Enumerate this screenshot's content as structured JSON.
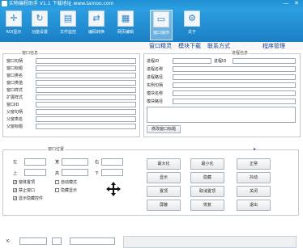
{
  "titlebar": {
    "title": "实物编程助手 V1.1 下载地址 www.tamoo.com",
    "minimize": "—",
    "close": "✕"
  },
  "toolbar": {
    "items": [
      {
        "label": "ROI显示",
        "icon": "✛"
      },
      {
        "label": "功能设置",
        "icon": "↻"
      },
      {
        "label": "文件监控",
        "icon": "▤"
      },
      {
        "label": "编码转换",
        "icon": "⇄"
      },
      {
        "label": "网页编辑",
        "icon": "▦"
      },
      {
        "label": "窗口操作",
        "icon": "▭"
      },
      {
        "label": "关于",
        "icon": "⚙"
      }
    ]
  },
  "menu": {
    "items": [
      "窗口精灵",
      "模块下载",
      "联系方式",
      "程序管理"
    ]
  },
  "window_group": {
    "title": "窗口信息",
    "fields": [
      "窗口句柄",
      "窗口标题",
      "窗口类名",
      "窗口类值",
      "窗口样式",
      "扩展样式",
      "窗口ID",
      "父窗句柄",
      "父窗类名",
      "父窗标题"
    ]
  },
  "process_group": {
    "title": "进程信息",
    "process_id_label": "进程ID",
    "thread_id_label": "进程ID",
    "fields": [
      "进程名称",
      "进程路径",
      "实例句柄",
      "模块名称",
      "模块路径"
    ],
    "modify_title_button": "修改窗口标题"
  },
  "position_group": {
    "title": "窗口位置",
    "left": "左",
    "width": "宽",
    "right": "右",
    "top": "上",
    "height": "高",
    "bottom": "下",
    "checkboxes": [
      {
        "label": "窗体置顶",
        "checked": true
      },
      {
        "label": "自动模式",
        "checked": false
      },
      {
        "label": "禁止窗口",
        "checked": true
      },
      {
        "label": "隐藏显示",
        "checked": false
      },
      {
        "label": "显示隐藏控件",
        "checked": true
      }
    ]
  },
  "actions": {
    "buttons": [
      "最大化",
      "最小化",
      "正常",
      "显示",
      "隐藏",
      "抖动",
      "置顶",
      "取消置顶",
      "关闭",
      "屏蔽",
      "恢复",
      "退出"
    ]
  },
  "bottom": {
    "k_label": "K:"
  }
}
